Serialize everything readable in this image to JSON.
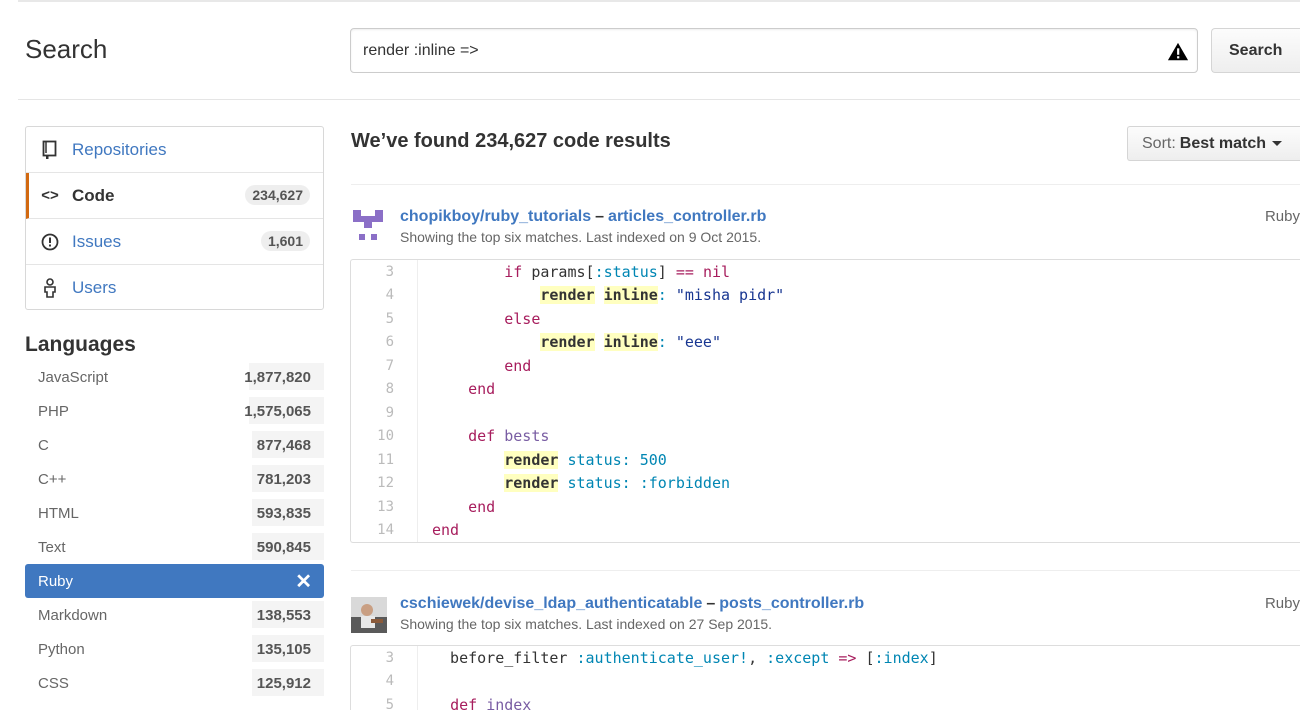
{
  "header": {
    "title": "Search",
    "query": "render :inline =>",
    "search_button": "Search"
  },
  "sidebar": {
    "nav": [
      {
        "label": "Repositories",
        "count": "",
        "icon": "repo-icon"
      },
      {
        "label": "Code",
        "count": "234,627",
        "icon": "code-icon"
      },
      {
        "label": "Issues",
        "count": "1,601",
        "icon": "issue-icon"
      },
      {
        "label": "Users",
        "count": "",
        "icon": "person-icon"
      }
    ],
    "languages_title": "Languages",
    "languages": [
      {
        "name": "JavaScript",
        "count": "1,877,820",
        "share": 0.25
      },
      {
        "name": "PHP",
        "count": "1,575,065",
        "share": 0.25
      },
      {
        "name": "C",
        "count": "877,468",
        "share": 0.24
      },
      {
        "name": "C++",
        "count": "781,203",
        "share": 0.24
      },
      {
        "name": "HTML",
        "count": "593,835",
        "share": 0.24
      },
      {
        "name": "Text",
        "count": "590,845",
        "share": 0.24
      },
      {
        "name": "Ruby",
        "count": "",
        "share": 0,
        "active": true,
        "close": "✕"
      },
      {
        "name": "Markdown",
        "count": "138,553",
        "share": 0.24
      },
      {
        "name": "Python",
        "count": "135,105",
        "share": 0.24
      },
      {
        "name": "CSS",
        "count": "125,912",
        "share": 0.24
      }
    ]
  },
  "results": {
    "summary": "We’ve found 234,627 code results",
    "sort_label": "Sort:",
    "sort_value": "Best match",
    "items": [
      {
        "repo": "chopikboy/ruby_tutorials",
        "separator": "–",
        "file": "articles_controller.rb",
        "meta": "Showing the top six matches. Last indexed on 9 Oct 2015.",
        "language": "Ruby"
      },
      {
        "repo": "cschiewek/devise_ldap_authenticatable",
        "separator": "–",
        "file": "posts_controller.rb",
        "meta": "Showing the top six matches. Last indexed on 27 Sep 2015.",
        "language": "Ruby"
      }
    ]
  },
  "colors": {
    "link": "#4078c0",
    "selected_border": "#d26911",
    "active_language": "#4078c0",
    "highlight": "#ffffc0"
  }
}
